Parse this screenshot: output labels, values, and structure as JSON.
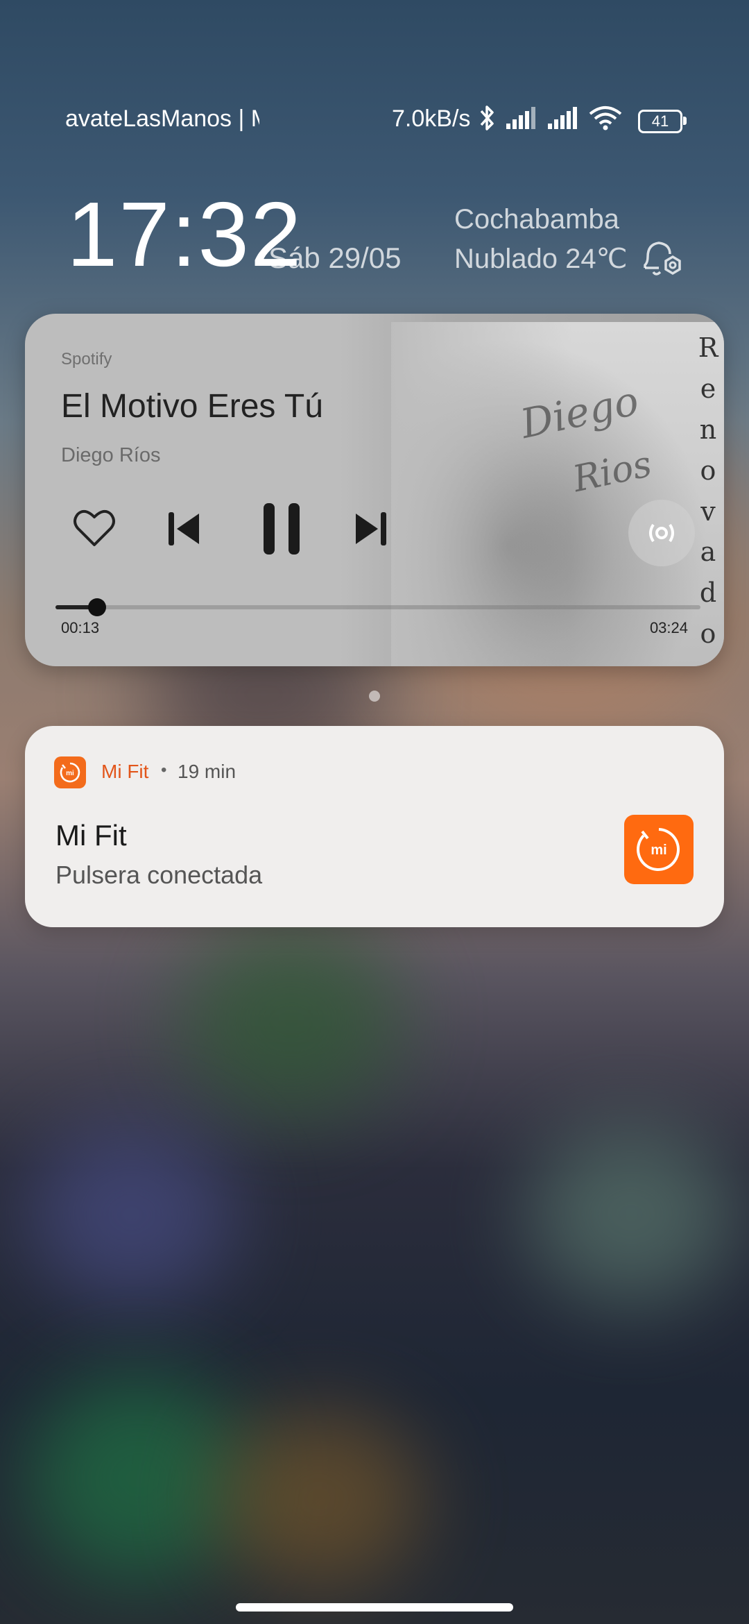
{
  "status_bar": {
    "ticker": "avateLasManos | M",
    "network_speed": "7.0kB/s",
    "battery": "41",
    "icons": [
      "bluetooth-icon",
      "signal-icon",
      "signal-icon",
      "wifi-icon",
      "battery-icon"
    ]
  },
  "lockscreen": {
    "time": "17:32",
    "date": "Sáb 29/05",
    "weather_city": "Cochabamba",
    "weather_condition": "Nublado 24℃",
    "alarm_icon": "alarm-settings-icon"
  },
  "media": {
    "app": "Spotify",
    "title": "El Motivo Eres Tú",
    "artist": "Diego Ríos",
    "elapsed": "00:13",
    "duration": "03:24",
    "progress_fraction": 0.064,
    "album_art_text": {
      "signature_line1": "Diego",
      "signature_line2": "Rios",
      "vertical": "Renovado"
    },
    "controls": [
      "heart-icon",
      "previous-icon",
      "pause-icon",
      "next-icon",
      "output-device-icon"
    ]
  },
  "notification": {
    "app_name": "Mi Fit",
    "separator": "•",
    "time_ago": "19 min",
    "title": "Mi Fit",
    "body": "Pulsera conectada",
    "accent_color": "#ff6a10"
  }
}
